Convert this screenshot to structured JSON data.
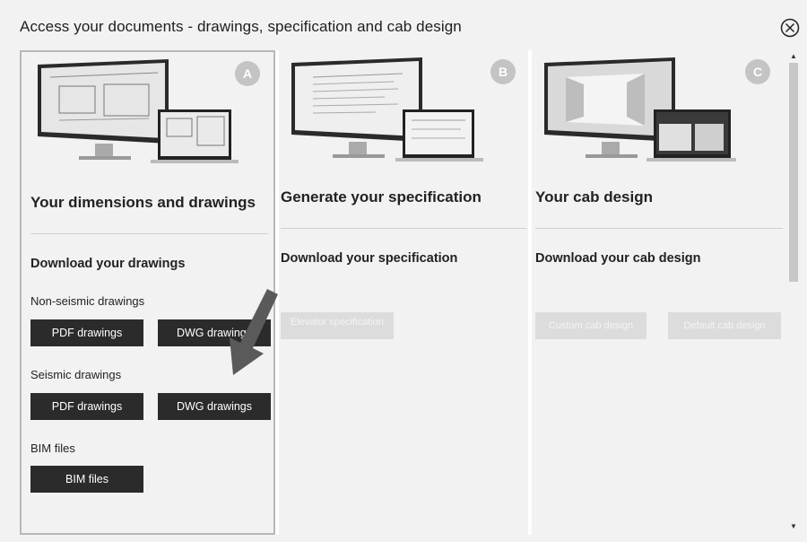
{
  "dialog": {
    "title": "Access your documents - drawings, specification and cab design"
  },
  "icons": {
    "close": "close-circle-icon",
    "scroll_up": "scroll-up-arrow-icon",
    "scroll_down": "scroll-down-arrow-icon",
    "pointer": "down-left-arrow-icon"
  },
  "panels": {
    "a": {
      "badge": "A",
      "title": "Your dimensions and drawings",
      "section": "Download your drawings",
      "groups": [
        {
          "label": "Non-seismic drawings",
          "buttons": [
            "PDF drawings",
            "DWG drawings"
          ]
        },
        {
          "label": "Seismic drawings",
          "buttons": [
            "PDF drawings",
            "DWG drawings"
          ]
        },
        {
          "label": "BIM files",
          "buttons": [
            "BIM files"
          ]
        }
      ]
    },
    "b": {
      "badge": "B",
      "title": "Generate your specification",
      "section": "Download your specification",
      "button": "Elevator specification"
    },
    "c": {
      "badge": "C",
      "title": "Your cab design",
      "section": "Download your cab design",
      "buttons": [
        "Custom cab design",
        "Default cab design"
      ]
    }
  },
  "colors": {
    "button_dark": "#2b2b2b",
    "button_disabled": "#dcdcdc",
    "badge": "#c4c4c4"
  }
}
